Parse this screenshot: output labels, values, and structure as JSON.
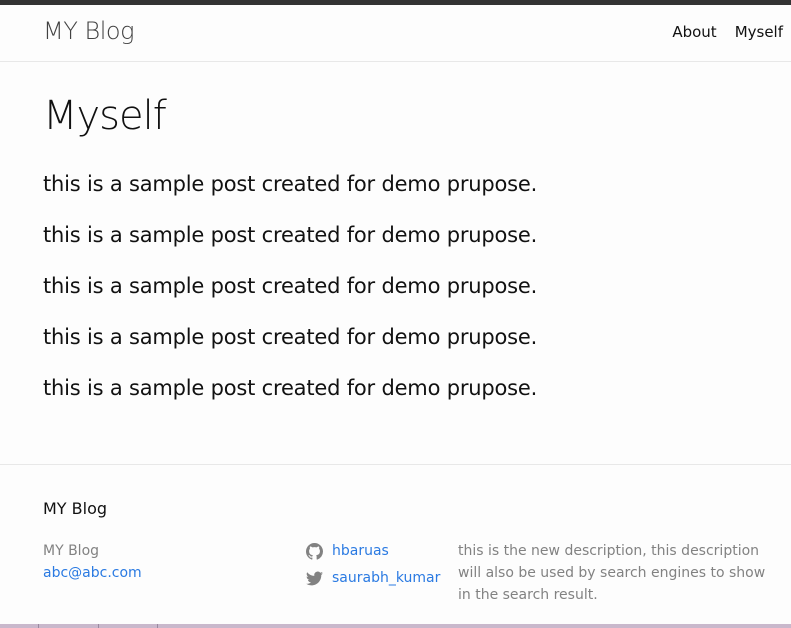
{
  "header": {
    "site_title": "MY Blog",
    "nav": [
      {
        "label": "About"
      },
      {
        "label": "Myself"
      }
    ]
  },
  "page": {
    "title": "Myself",
    "paragraphs": [
      "this is a sample post created for demo prupose.",
      "this is a sample post created for demo prupose.",
      "this is a sample post created for demo prupose.",
      "this is a sample post created for demo prupose.",
      "this is a sample post created for demo prupose."
    ]
  },
  "footer": {
    "heading": "MY Blog",
    "name": "MY Blog",
    "email": "abc@abc.com",
    "github_username": "hbaruas",
    "twitter_username": "saurabh_kumar",
    "description": "this is the new description, this description will also be used by search engines to show in the search result."
  },
  "colors": {
    "link": "#2a7ae2",
    "text": "#111111",
    "muted": "#828282",
    "top_rule": "#333333"
  },
  "icons": {
    "github": "github-icon",
    "twitter": "twitter-icon"
  }
}
